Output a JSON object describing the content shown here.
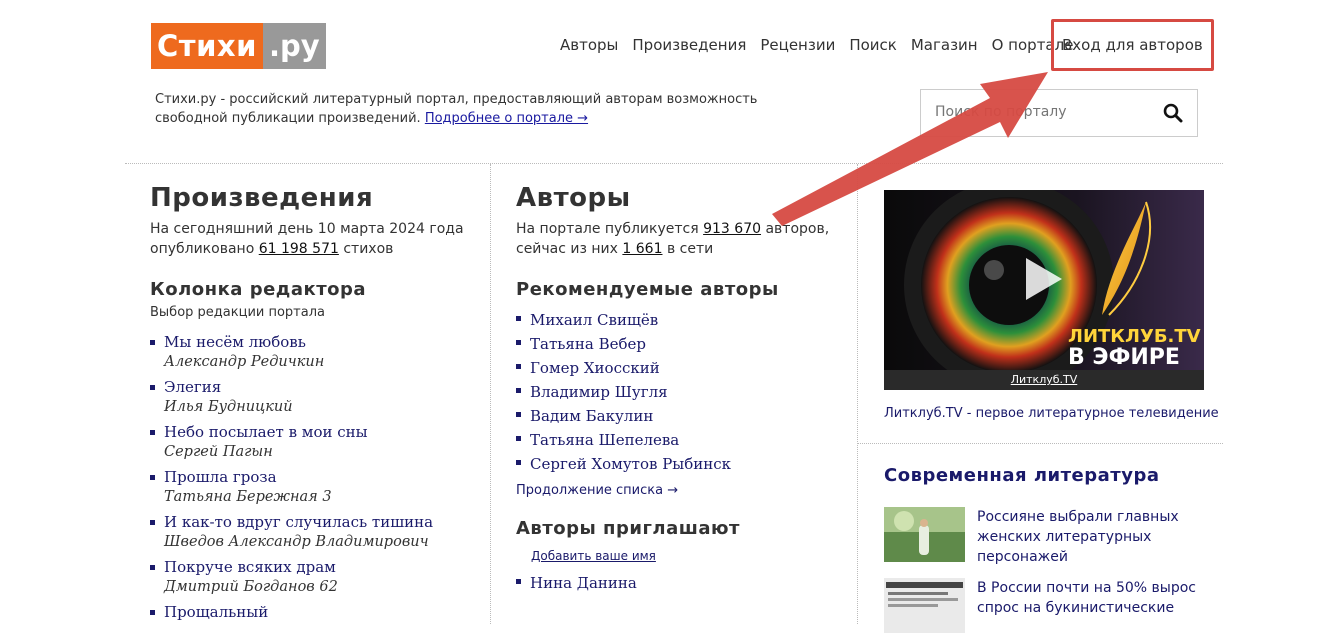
{
  "header": {
    "logo_main": "Стихи",
    "logo_domain": ".ру",
    "nav": [
      "Авторы",
      "Произведения",
      "Рецензии",
      "Поиск",
      "Магазин",
      "О портале"
    ],
    "login": "Вход для авторов"
  },
  "tagline": {
    "text": "Стихи.ру - российский литературный портал, предоставляющий авторам возможность свободной публикации произведений.",
    "link": "Подробнее о портале →"
  },
  "search": {
    "placeholder": "Поиск по порталу"
  },
  "works": {
    "title": "Произведения",
    "lead_pre": "На сегодняшний день 10 марта 2024 года опубликовано",
    "count": "61 198 571",
    "lead_post": "стихов",
    "editor_title": "Колонка редактора",
    "editor_sub": "Выбор редакции портала",
    "items": [
      {
        "title": "Мы несём любовь",
        "author": "Александр Редичкин"
      },
      {
        "title": "Элегия",
        "author": "Илья Будницкий"
      },
      {
        "title": "Небо посылает в мои сны",
        "author": "Сергей Пагын"
      },
      {
        "title": "Прошла гроза",
        "author": "Татьяна Бережная 3"
      },
      {
        "title": "И как-то вдруг случилась тишина",
        "author": "Шведов Александр Владимирович"
      },
      {
        "title": "Покруче всяких драм",
        "author": "Дмитрий Богданов 62"
      },
      {
        "title": "Прощальный",
        "author": ""
      }
    ]
  },
  "authors": {
    "title": "Авторы",
    "lead_pre": "На портале публикуется",
    "count": "913 670",
    "lead_mid": "авторов, сейчас из них",
    "online": "1 661",
    "lead_post": "в сети",
    "rec_title": "Рекомендуемые авторы",
    "rec": [
      "Михаил Свищёв",
      "Татьяна Вебер",
      "Гомер Хиосский",
      "Владимир Шугля",
      "Вадим Бакулин",
      "Татьяна Шепелева",
      "Сергей Хомутов Рыбинск"
    ],
    "more": "Продолжение списка →",
    "invite_title": "Авторы приглашают",
    "add_name": "Добавить ваше имя",
    "invite": [
      "Нина Данина"
    ]
  },
  "right": {
    "video_caption": "Литклуб.TV",
    "video_logo_1": "ЛИТКЛУБ.TV",
    "video_logo_2": "В ЭФИРЕ",
    "video_desc": "Литклуб.TV - первое литературное телевидение",
    "lit_title": "Современная литература",
    "news": [
      "Россияне выбрали главных женских литературных персонажей",
      "В России почти на 50% вырос спрос на букинистические"
    ]
  },
  "colors": {
    "brand_orange": "#ee6a1e",
    "link_blue": "#1a1a6a",
    "annotation_red": "#d64a42"
  }
}
